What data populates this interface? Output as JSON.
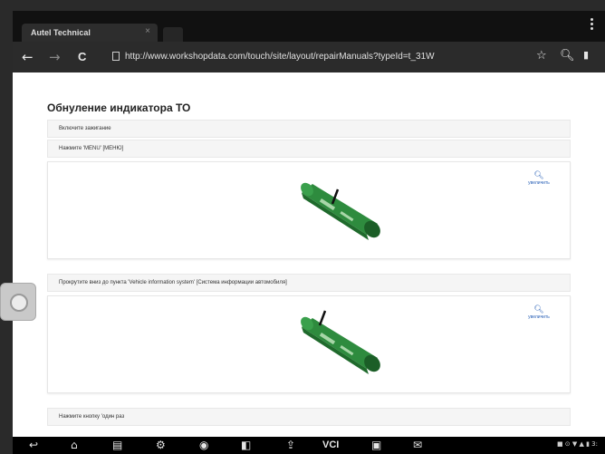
{
  "browser": {
    "tab_title": "Autel Technical",
    "tab_close": "×",
    "url": "http://www.workshopdata.com/touch/site/layout/repairManuals?typeId=t_31W",
    "back": "←",
    "forward": "→",
    "reload": "C",
    "star": "☆",
    "search": "🔍︎"
  },
  "page": {
    "title": "Обнуление индикатора ТО",
    "steps": [
      "Включите зажигание",
      "Нажмите 'MENU' [МЕНЮ]",
      "Прокрутите вниз до пункта 'Vehicle information system' [Система информации автомобиля]",
      "Нажмите кнопку 'один раз"
    ],
    "zoom_label": "увеличить"
  },
  "colors": {
    "part_green": "#2e8b3e",
    "link_blue": "#2d63b8"
  },
  "navbar": {
    "vci_label": "VCI",
    "status": "■ ⊙ ▼ ▲ ▮ 3:"
  }
}
